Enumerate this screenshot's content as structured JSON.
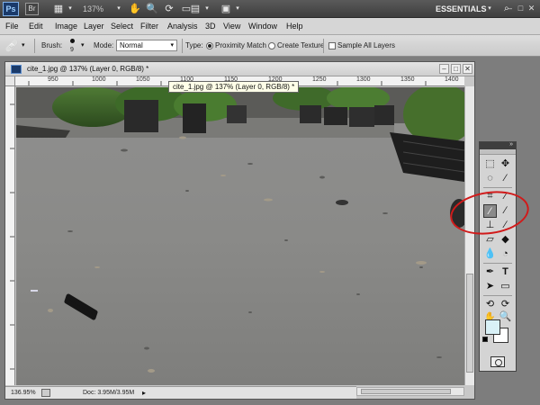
{
  "appbar": {
    "ps_logo": "Ps",
    "br_logo": "Br",
    "zoom": "137%",
    "workspace": "ESSENTIALS",
    "icons": [
      "layout-icon",
      "hand-icon",
      "zoom-icon",
      "rotate-icon",
      "arrange-icon",
      "screen-mode-icon",
      "search-icon"
    ]
  },
  "menu": [
    "File",
    "Edit",
    "Image",
    "Layer",
    "Select",
    "Filter",
    "Analysis",
    "3D",
    "View",
    "Window",
    "Help"
  ],
  "options": {
    "brush_label": "Brush:",
    "brush_size": "9",
    "mode_label": "Mode:",
    "mode_value": "Normal",
    "type_label": "Type:",
    "proximity_label": "Proximity Match",
    "texture_label": "Create Texture",
    "sample_label": "Sample All Layers"
  },
  "document": {
    "title": "cite_1.jpg @ 137% (Layer 0, RGB/8) *",
    "tooltip": "cite_1.jpg @ 137% (Layer 0, RGB/8) *",
    "ruler_labels": [
      "950",
      "1000",
      "1050",
      "1100",
      "1150",
      "1200",
      "1250",
      "1300",
      "1350",
      "1400"
    ],
    "status_zoom": "136.95%",
    "status_doc": "Doc: 3.95M/3.95M"
  },
  "colors": {
    "foreground": "#d9f1f7",
    "background": "#ffffff",
    "annotation": "#d11a1a"
  }
}
